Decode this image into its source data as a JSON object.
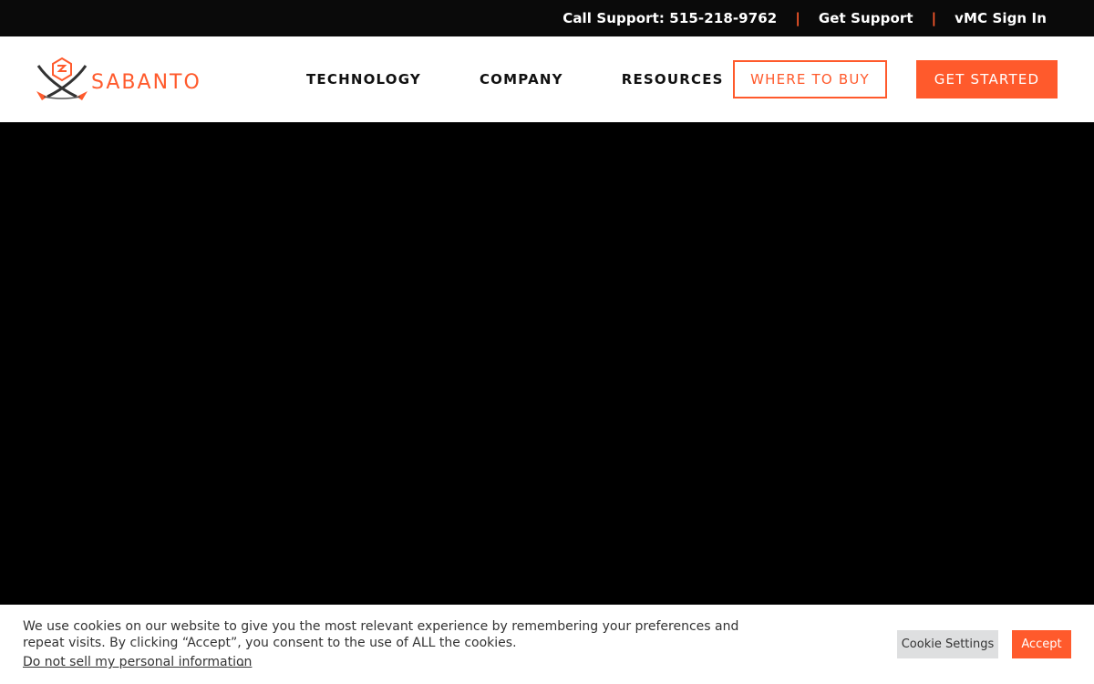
{
  "topbar": {
    "call_support": "Call Support: 515-218-9762",
    "separator": "|",
    "get_support": "Get Support",
    "vmc_sign_in": "vMC Sign In"
  },
  "brand": {
    "name": "SABANTO",
    "accent_color": "#ff5a2c"
  },
  "nav": {
    "items": [
      {
        "label": "TECHNOLOGY"
      },
      {
        "label": "COMPANY"
      },
      {
        "label": "RESOURCES"
      }
    ],
    "where_to_buy": "WHERE TO BUY",
    "get_started": "GET STARTED"
  },
  "cookie": {
    "message": "We use cookies on our website to give you the most relevant experience by remembering your preferences and repeat visits. By clicking “Accept”, you consent to the use of ALL the cookies.",
    "do_not_sell": "Do not sell my personal information",
    "period": ".",
    "settings_label": "Cookie Settings",
    "accept_label": "Accept"
  }
}
